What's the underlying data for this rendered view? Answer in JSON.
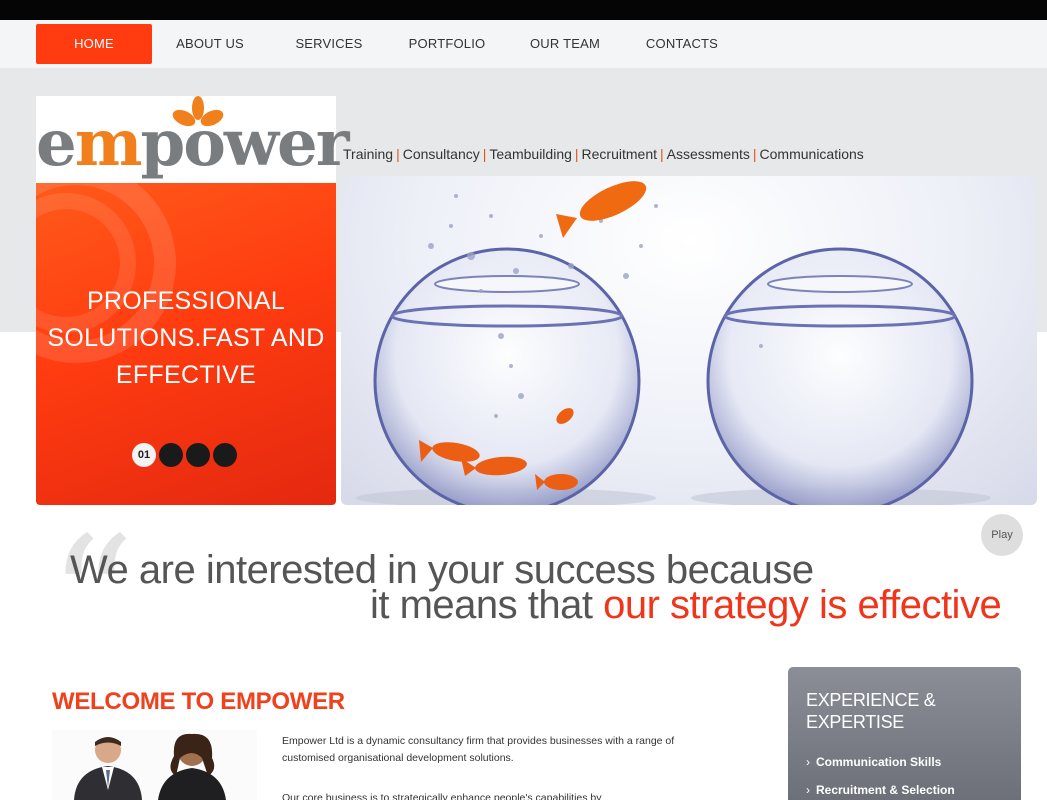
{
  "nav": {
    "items": [
      {
        "label": "HOME"
      },
      {
        "label": "ABOUT US"
      },
      {
        "label": "SERVICES"
      },
      {
        "label": "PORTFOLIO"
      },
      {
        "label": "OUR TEAM"
      },
      {
        "label": "CONTACTS"
      }
    ]
  },
  "brand": {
    "logo_prefix": "e",
    "logo_m": "m",
    "logo_suffix": "power",
    "accent": "#ff3b0f",
    "logo_orange": "#f07f1c"
  },
  "services": [
    "Training",
    "Consultancy",
    "Teambuilding",
    "Recruitment",
    "Assessments",
    "Communications"
  ],
  "service_separator": "|",
  "promo": {
    "line1": "PROFESSIONAL",
    "line2": "SOLUTIONS.FAST AND",
    "line3": "EFFECTIVE",
    "current_slide": "01"
  },
  "play_label": "Play",
  "slogan": {
    "line1": "We are  interested in your success because",
    "line2_plain": "it means that ",
    "line2_highlight": "our strategy is effective"
  },
  "welcome": {
    "title": "WELCOME TO EMPOWER",
    "para1": "Empower Ltd is a dynamic consultancy firm that provides businesses with a range of customised organisational development solutions.",
    "para2": "Our core business is to strategically enhance people's capabilities by"
  },
  "experience": {
    "title_line1": "EXPERIENCE &",
    "title_line2": "EXPERTISE",
    "items": [
      {
        "label": "Communication Skills"
      },
      {
        "label": "Recruitment & Selection"
      }
    ]
  }
}
